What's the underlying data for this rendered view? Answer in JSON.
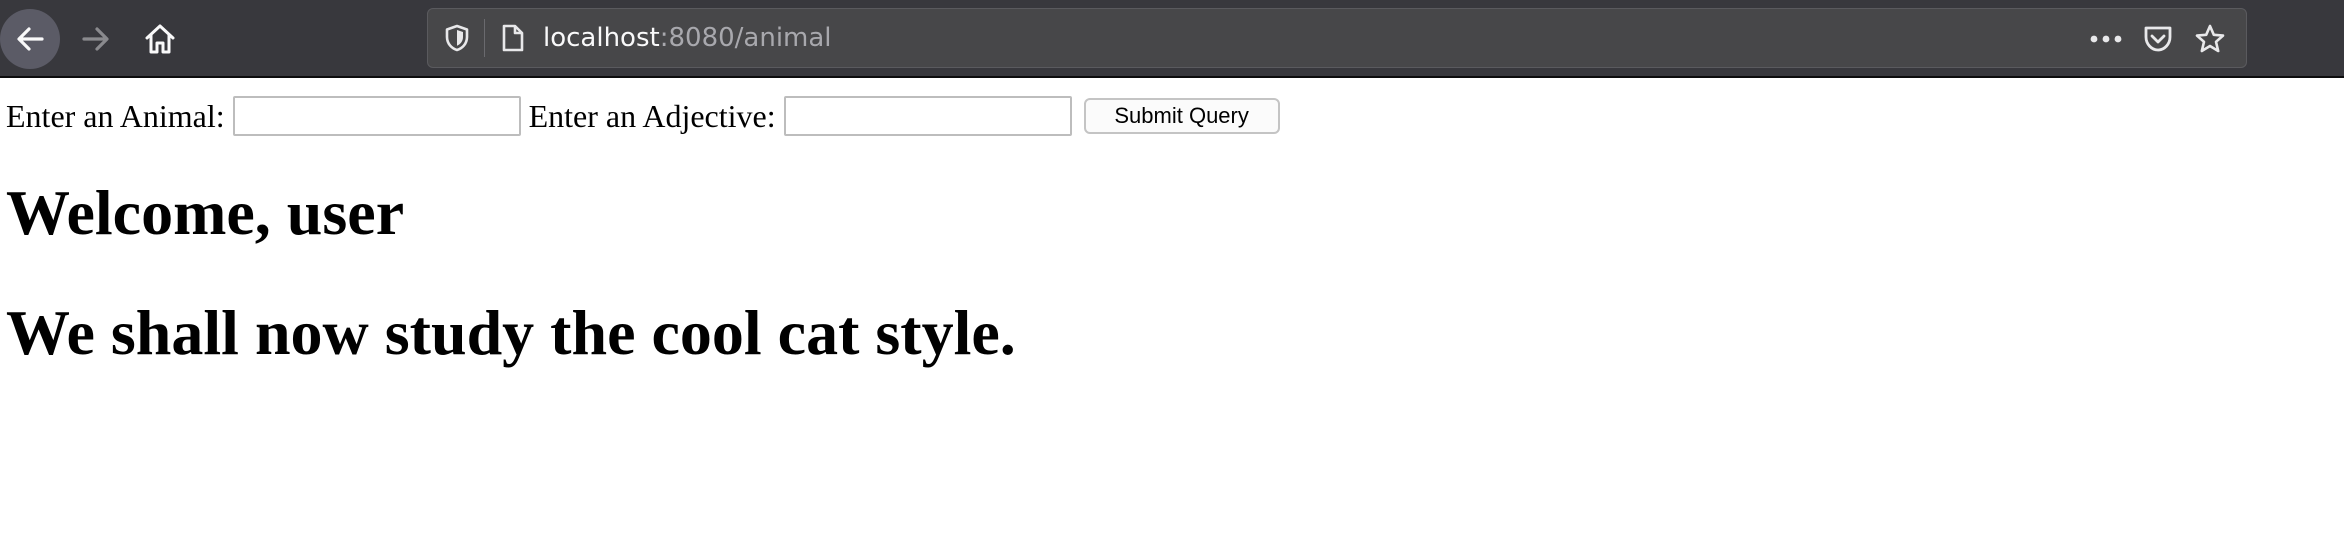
{
  "browser": {
    "url": {
      "host": "localhost",
      "path": ":8080/animal"
    },
    "icons": {
      "back": "back-arrow-icon",
      "forward": "forward-arrow-icon",
      "home": "home-icon",
      "tracking_protection": "shield-icon",
      "page_info": "page-icon",
      "page_actions": "more-icon",
      "pocket": "pocket-icon",
      "bookmark": "star-icon"
    },
    "colors": {
      "toolbar_bg": "#38383d",
      "urlbar_bg": "#474749",
      "url_host": "#f9f9fa",
      "url_path": "#a8a8ad"
    }
  },
  "form": {
    "animal_label": "Enter an Animal:",
    "animal_value": "",
    "adjective_label": "Enter an Adjective:",
    "adjective_value": "",
    "submit_label": "Submit Query"
  },
  "page": {
    "welcome_heading": "Welcome, user",
    "study_heading": "We shall now study the cool cat style."
  }
}
